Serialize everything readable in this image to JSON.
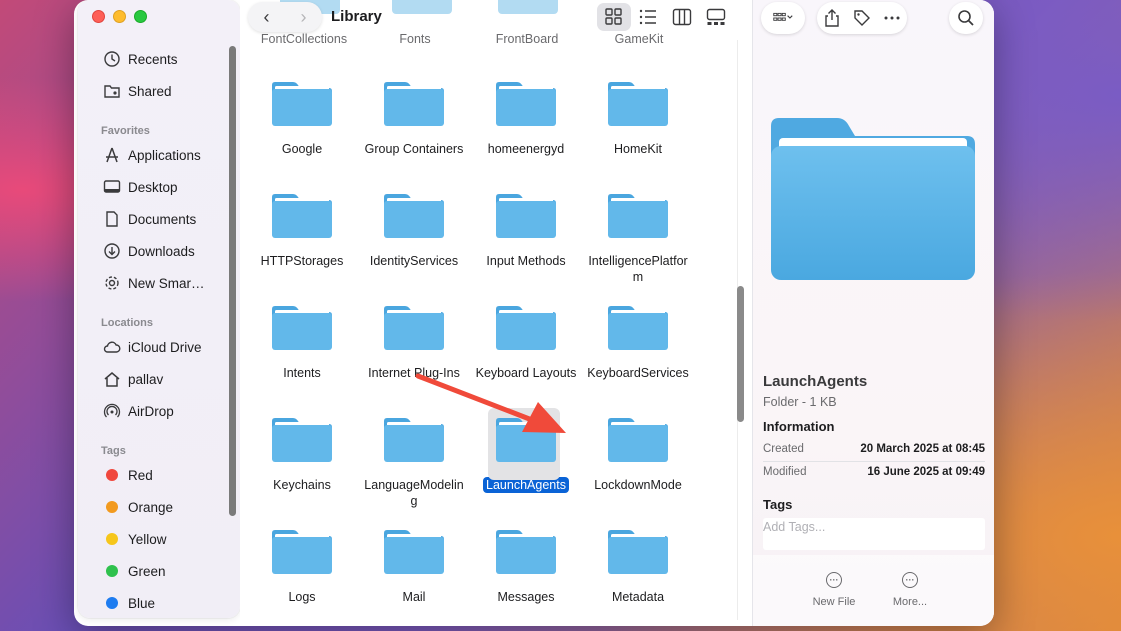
{
  "window": {
    "title": "Library",
    "colors": {
      "accent": "#0a63d6",
      "folder": "#5fb4e6",
      "arrow": "#f04a3a"
    }
  },
  "sidebar": {
    "top_items": [
      {
        "label": "Recents",
        "icon": "clock-icon"
      },
      {
        "label": "Shared",
        "icon": "shared-folder-icon"
      }
    ],
    "favorites": {
      "heading": "Favorites",
      "items": [
        {
          "label": "Applications",
          "icon": "applications-icon"
        },
        {
          "label": "Desktop",
          "icon": "desktop-icon"
        },
        {
          "label": "Documents",
          "icon": "document-icon"
        },
        {
          "label": "Downloads",
          "icon": "download-icon"
        },
        {
          "label": "New Smar…",
          "icon": "gear-icon"
        }
      ]
    },
    "locations": {
      "heading": "Locations",
      "items": [
        {
          "label": "iCloud Drive",
          "icon": "cloud-icon"
        },
        {
          "label": "pallav",
          "icon": "home-icon"
        },
        {
          "label": "AirDrop",
          "icon": "airdrop-icon"
        }
      ]
    },
    "tags": {
      "heading": "Tags",
      "items": [
        {
          "label": "Red",
          "color": "#f0473d"
        },
        {
          "label": "Orange",
          "color": "#f29a1f"
        },
        {
          "label": "Yellow",
          "color": "#f6c61b"
        },
        {
          "label": "Green",
          "color": "#2fc14d"
        },
        {
          "label": "Blue",
          "color": "#1e7cf0"
        }
      ]
    }
  },
  "toolbar": {
    "back": "‹",
    "forward": "›",
    "views": [
      "icon-view",
      "list-view",
      "column-view",
      "gallery-view"
    ]
  },
  "files": {
    "top_partial": [
      "FontCollections",
      "Fonts",
      "FrontBoard",
      "GameKit"
    ],
    "rows": [
      [
        "Google",
        "Group Containers",
        "homeenergyd",
        "HomeKit"
      ],
      [
        "HTTPStorages",
        "IdentityServices",
        "Input Methods",
        "IntelligencePlatform"
      ],
      [
        "Intents",
        "Internet Plug-Ins",
        "Keyboard Layouts",
        "KeyboardServices"
      ],
      [
        "Keychains",
        "LanguageModeling",
        "LaunchAgents",
        "LockdownMode"
      ],
      [
        "Logs",
        "Mail",
        "Messages",
        "Metadata"
      ]
    ],
    "selected": "LaunchAgents"
  },
  "inspector": {
    "name": "LaunchAgents",
    "kind": "Folder - 1 KB",
    "info_heading": "Information",
    "created_label": "Created",
    "created_value": "20 March 2025 at 08:45",
    "modified_label": "Modified",
    "modified_value": "16 June 2025 at 09:49",
    "tags_heading": "Tags",
    "tags_placeholder": "Add Tags...",
    "actions": [
      {
        "label": "New File"
      },
      {
        "label": "More..."
      }
    ]
  }
}
